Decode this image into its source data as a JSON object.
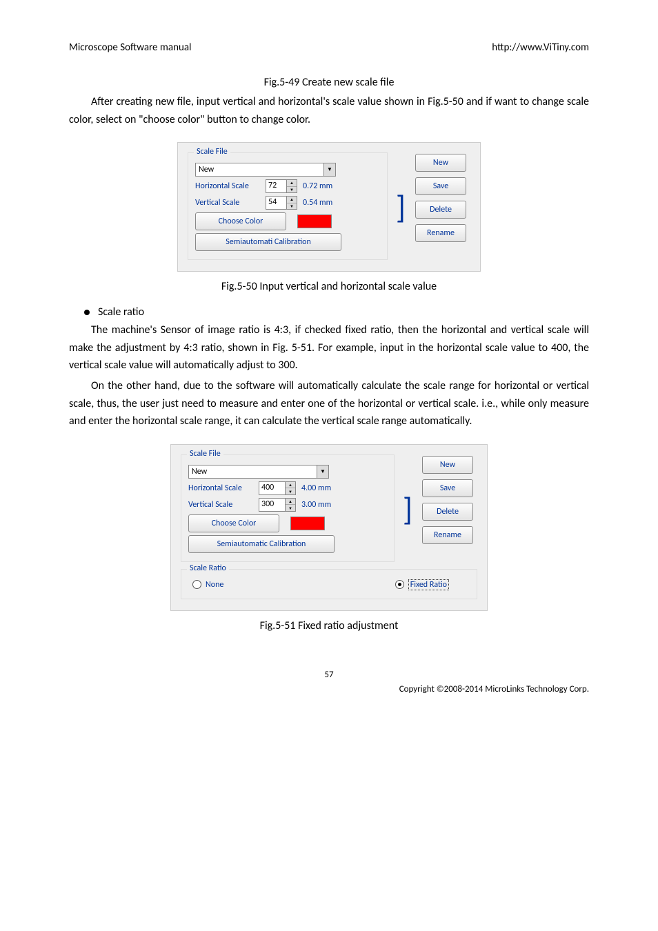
{
  "header": {
    "left": "Microscope Software manual",
    "right": "http://www.ViTiny.com"
  },
  "fig49_title": "Fig.5-49 Create new scale file",
  "para1": "After creating new file, input vertical and horizontal's scale value shown in Fig.5-50 and if want to change scale color, select on \"choose color\" button to change color.",
  "panel1": {
    "group_label": "Scale File",
    "dropdown_value": "New",
    "hscale_label": "Horizontal Scale",
    "hscale_value": "72",
    "hscale_unit": "0.72 mm",
    "vscale_label": "Vertical Scale",
    "vscale_value": "54",
    "vscale_unit": "0.54 mm",
    "choose_color_label": "Choose Color",
    "semi_label": "Semiautomati Calibration",
    "new_btn": "New",
    "save_btn": "Save",
    "delete_btn": "Delete",
    "rename_btn": "Rename",
    "color_hex": "#ff0000"
  },
  "fig50_title": "Fig.5-50 Input vertical and horizontal scale value",
  "bullet1_label": "Scale ratio",
  "para2": "The machine's Sensor of image ratio is 4:3, if checked fixed ratio, then the horizontal and vertical scale will make the adjustment by 4:3 ratio, shown in Fig. 5-51. For example, input in the horizontal scale value to 400, the vertical scale value will automatically adjust to 300.",
  "para3": "On the other hand, due to the software  will automatically calculate the scale range for horizontal or vertical scale, thus, the user just need to measure and enter one of the horizontal or vertical scale. i.e., while only measure and enter the horizontal scale range, it can calculate the vertical scale range automatically.",
  "panel2": {
    "group_label": "Scale File",
    "dropdown_value": "New",
    "hscale_label": "Horizontal Scale",
    "hscale_value": "400",
    "hscale_unit": "4.00 mm",
    "vscale_label": "Vertical Scale",
    "vscale_value": "300",
    "vscale_unit": "3.00 mm",
    "choose_color_label": "Choose Color",
    "semi_label": "Semiautomatic Calibration",
    "new_btn": "New",
    "save_btn": "Save",
    "delete_btn": "Delete",
    "rename_btn": "Rename",
    "ratio_group_label": "Scale Ratio",
    "ratio_none": "None",
    "ratio_fixed": "Fixed Ratio",
    "color_hex": "#ff0000"
  },
  "fig51_title": "Fig.5-51 Fixed ratio adjustment",
  "footer": {
    "page": "57",
    "copyright": "Copyright ©2008-2014 MicroLinks Technology Corp."
  }
}
